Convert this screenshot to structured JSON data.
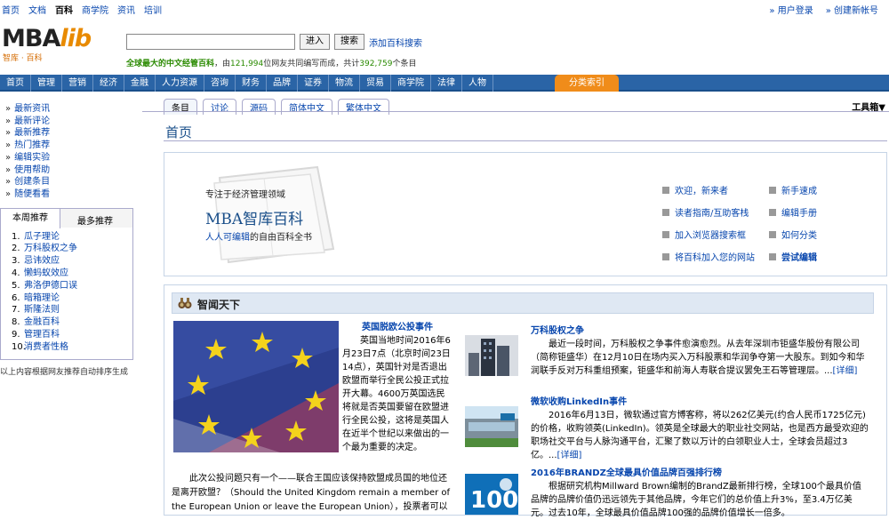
{
  "topbar": {
    "links": [
      "首页",
      "文档",
      "百科",
      "商学院",
      "资讯",
      "培训"
    ],
    "current_index": 2,
    "login": "» 用户登录",
    "register": "» 创建新帐号"
  },
  "logo": {
    "text_mba": "MBA",
    "text_lib": "lib",
    "sub": "智库 · 百科"
  },
  "search": {
    "go_label": "进入",
    "search_label": "搜索",
    "add_engine": "添加百科搜索"
  },
  "slogan": {
    "bold": "全球最大的中文经管百科",
    "pre": "，由",
    "editors": "121,994",
    "mid": "位网友共同编写而成，共计",
    "entries": "392,759",
    "post": "个条目"
  },
  "nav": {
    "items": [
      "首页",
      "管理",
      "营销",
      "经济",
      "金融",
      "人力资源",
      "咨询",
      "财务",
      "品牌",
      "证券",
      "物流",
      "贸易",
      "商学院",
      "法律",
      "人物"
    ],
    "category_index": "分类索引"
  },
  "sidebar": {
    "links": [
      "最新资讯",
      "最新评论",
      "最新推荐",
      "热门推荐",
      "编辑实验",
      "使用帮助",
      "创建条目",
      "随便看看"
    ],
    "tab_weekly": "本周推荐",
    "tab_most": "最多推荐",
    "recommended": [
      "瓜子理论",
      "万科股权之争",
      "忌讳效应",
      "懒蚂蚁效应",
      "弗洛伊德口误",
      "暗箱理论",
      "斯隆法则",
      "金融百科",
      "管理百科",
      "消费者性格"
    ],
    "note": "以上内容根据网友推荐自动排序生成"
  },
  "content_tabs": [
    "条目",
    "讨论",
    "源码",
    "简体中文",
    "繁体中文"
  ],
  "toolbox": "工具箱▼",
  "page_title": "首页",
  "intro": {
    "focus": "专注于经济管理领域",
    "name": "MBA智库百科",
    "tagline_link": "人人可编辑",
    "tagline_rest": "的自由百科全书",
    "links": [
      {
        "label": "欢迎，新来者",
        "bold": false
      },
      {
        "label": "新手速成",
        "bold": false
      },
      {
        "label": "读者指南/互助客栈",
        "bold": false
      },
      {
        "label": "编辑手册",
        "bold": false
      },
      {
        "label": "加入浏览器搜索框",
        "bold": false
      },
      {
        "label": "如何分类",
        "bold": false
      },
      {
        "label": "将百科加入您的网站",
        "bold": false
      },
      {
        "label": "尝试编辑",
        "bold": true
      }
    ]
  },
  "news": {
    "header": "智闻天下",
    "lead_title": "英国脱欧公投事件",
    "lead_text": "英国当地时间2016年6月23日7点（北京时间23日14点），英国针对是否退出欧盟而举行全民公投正式拉开大幕。4600万英国选民将就是否英国要留在欧盟进行全民公投，这将是英国人在近半个世纪以来做出的一个最为重要的决定。",
    "lead_more": "此次公投问题只有一个——联合王国应该保持欧盟成员国的地位还是离开欧盟？（Should the United Kingdom remain a member of the European Union or leave the European Union），投票者可以",
    "items": [
      {
        "title": "万科股权之争",
        "text": "最近一段时间，万科股权之争事件愈演愈烈。从去年深圳市钜盛华股份有限公司（简称钜盛华）在12月10日在场内买入万科股票和华润争夺第一大股东。到如今和华润联手反对万科重组预案，钜盛华和前海人寿联合提议罢免王石等管理层。...",
        "more": "[详细]"
      },
      {
        "title": "微软收购LinkedIn事件",
        "text": "2016年6月13日，微软通过官方博客称，将以262亿美元(约合人民币1725亿元)的价格，收购领英(LinkedIn)。领英是全球最大的职业社交网站，也是西方最受欢迎的职场社交平台与人脉沟通平台，汇聚了数以万计的白领职业人士，全球会员超过3亿。...",
        "more": "[详细]"
      },
      {
        "title": "2016年BRANDZ全球最具价值品牌百强排行榜",
        "text": "根据研究机构Millward Brown编制的BrandZ最新排行榜，全球100个最具价值品牌的品牌价值仍迅远领先于其他品牌，今年它们的总价值上升3%，至3.4万亿美元。过去10年，全球最具价值品牌100强的品牌价值增长一倍多。",
        "more": ""
      }
    ]
  }
}
